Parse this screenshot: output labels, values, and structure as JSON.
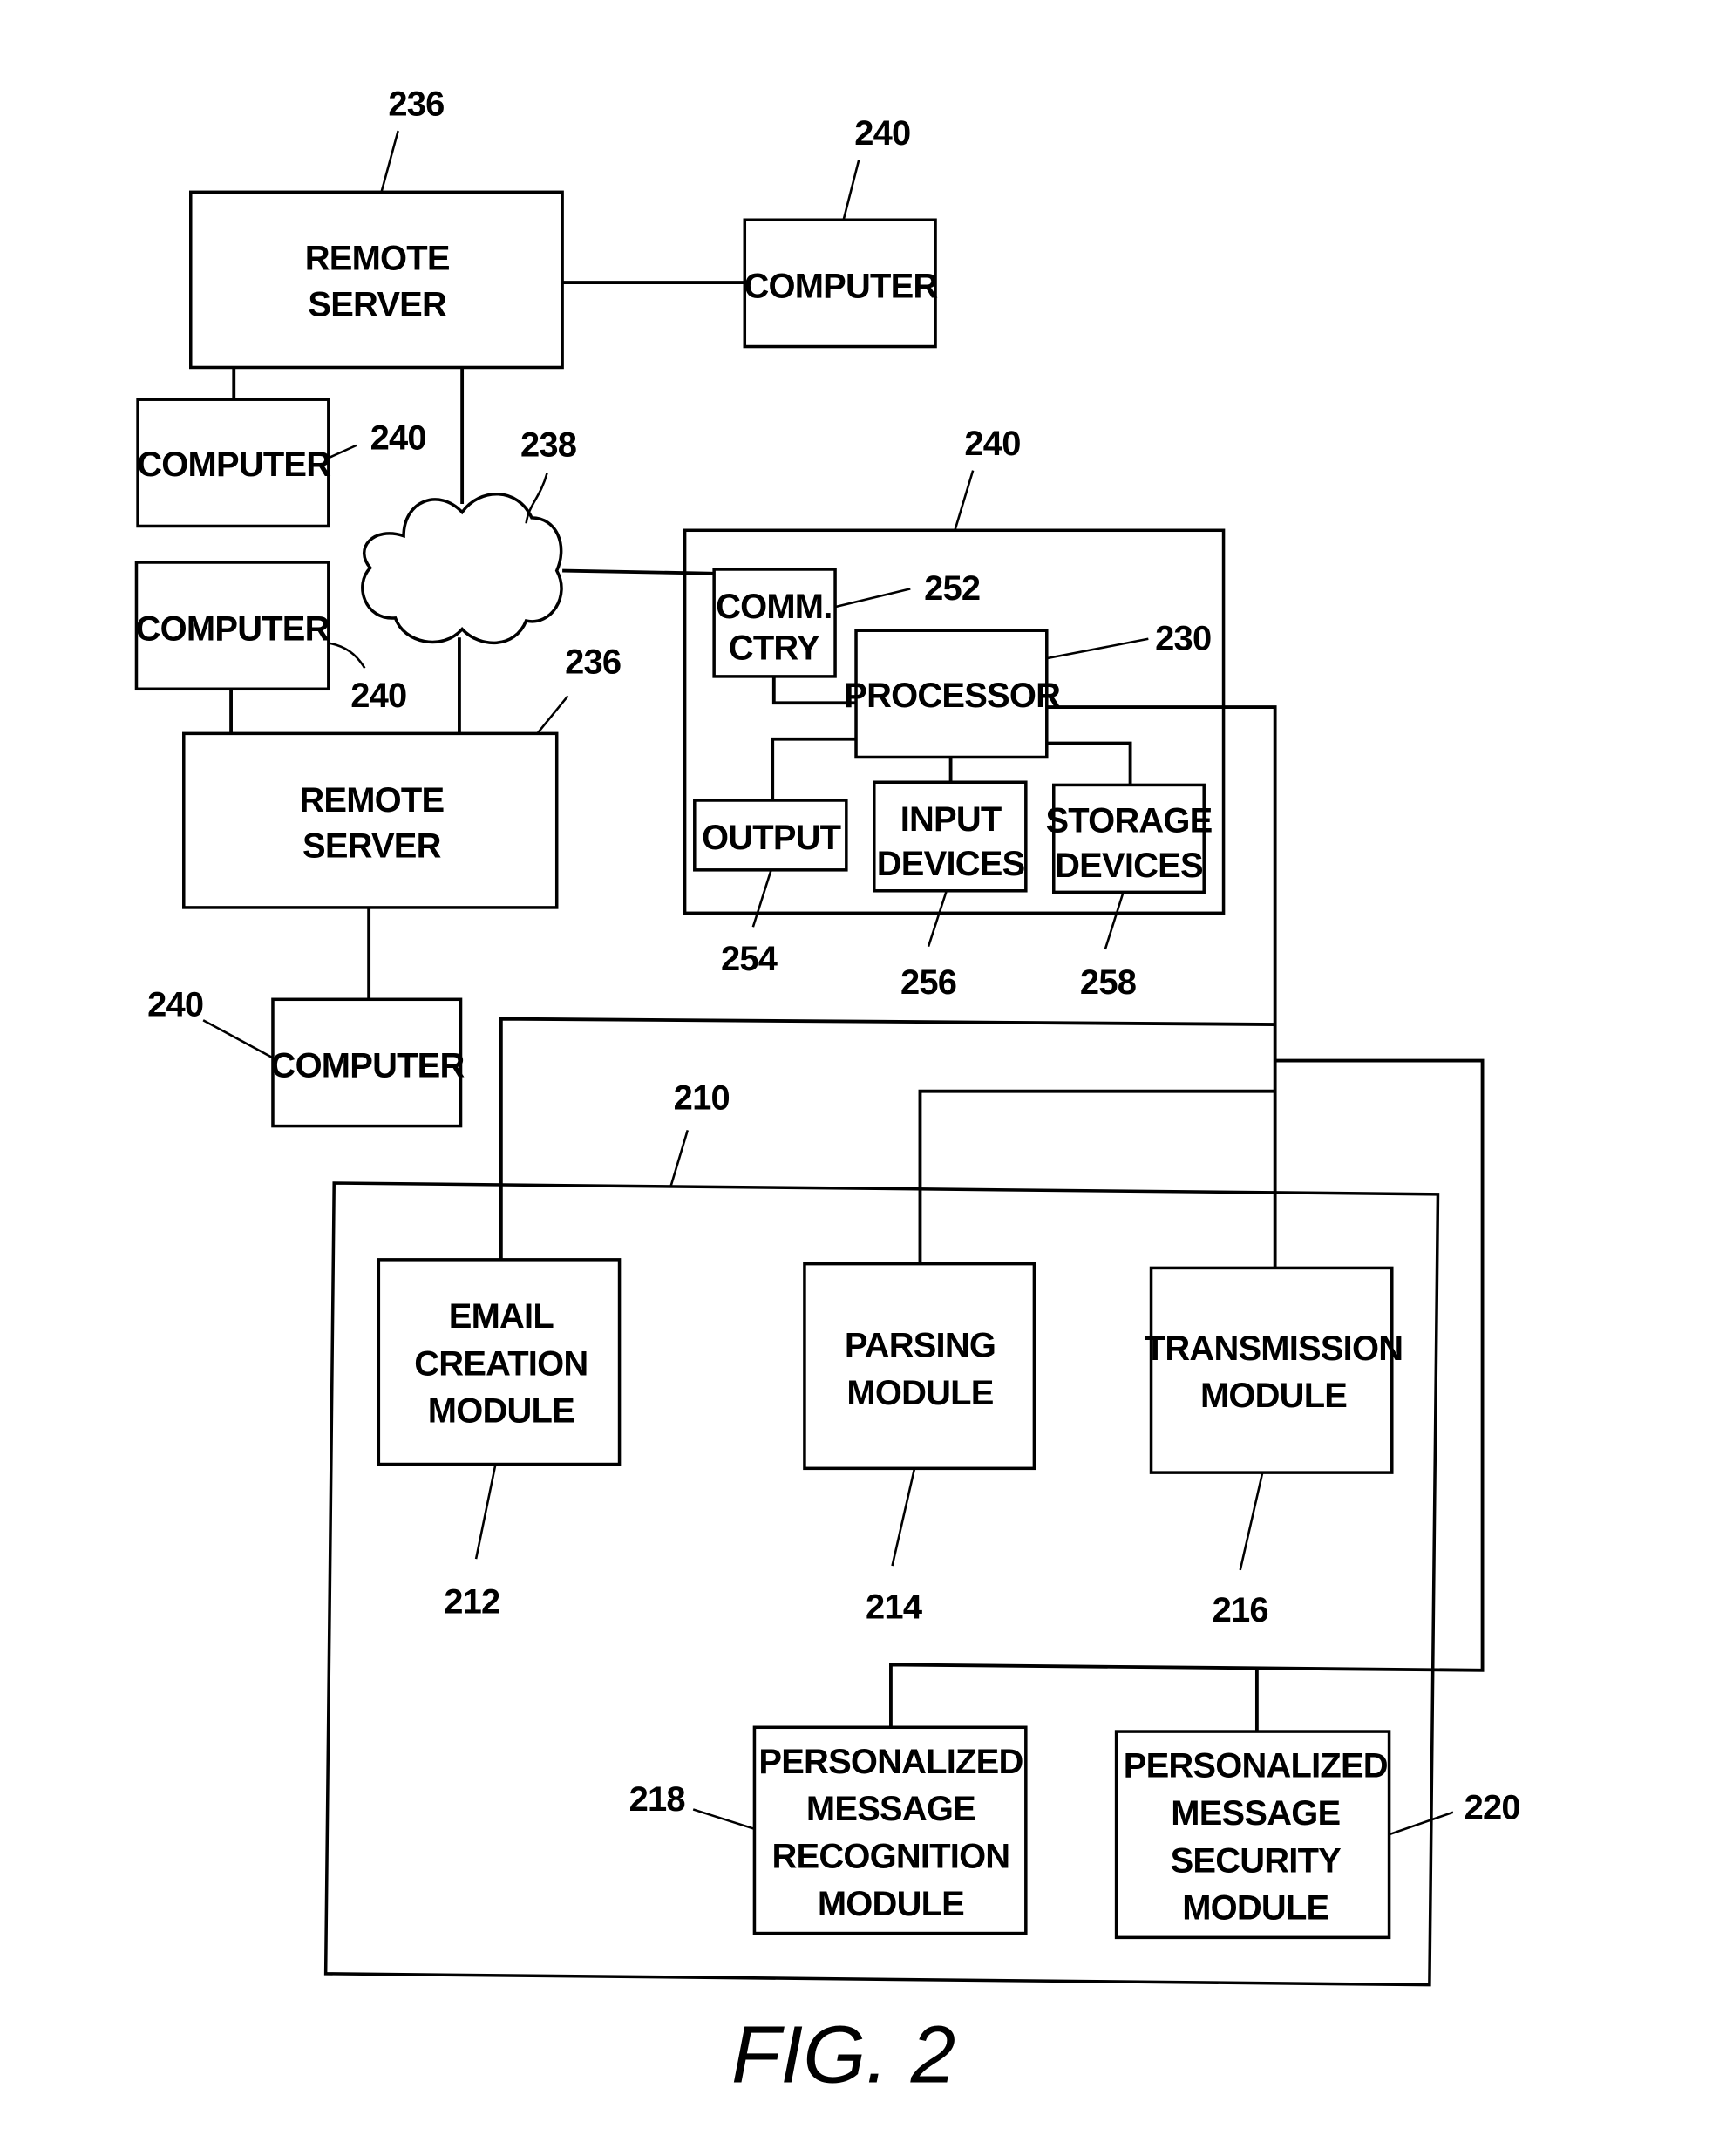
{
  "figure": {
    "caption": "FIG. 2",
    "nodes": {
      "remote_server_top": {
        "lines": [
          "REMOTE",
          "SERVER"
        ],
        "ref": "236"
      },
      "computer_top_right": {
        "lines": [
          "COMPUTER"
        ],
        "ref": "240"
      },
      "computer_left_1": {
        "lines": [
          "COMPUTER"
        ],
        "ref": "240"
      },
      "network": {
        "ref": "238"
      },
      "computer_left_2": {
        "lines": [
          "COMPUTER"
        ],
        "ref": "240"
      },
      "remote_server_bottom": {
        "lines": [
          "REMOTE",
          "SERVER"
        ],
        "ref": "236"
      },
      "computer_bottom": {
        "lines": [
          "COMPUTER"
        ],
        "ref": "240"
      },
      "computer_system": {
        "ref": "240"
      },
      "comm_ctry": {
        "lines": [
          "COMM.",
          "CTRY"
        ],
        "ref": "252"
      },
      "processor": {
        "lines": [
          "PROCESSOR"
        ],
        "ref": "230"
      },
      "output": {
        "lines": [
          "OUTPUT"
        ],
        "ref": "254"
      },
      "input_devices": {
        "lines": [
          "INPUT",
          "DEVICES"
        ],
        "ref": "256"
      },
      "storage_devices": {
        "lines": [
          "STORAGE",
          "DEVICES"
        ],
        "ref": "258"
      },
      "module_system": {
        "ref": "210"
      },
      "email_creation": {
        "lines": [
          "EMAIL",
          "CREATION",
          "MODULE"
        ],
        "ref": "212"
      },
      "parsing": {
        "lines": [
          "PARSING",
          "MODULE"
        ],
        "ref": "214"
      },
      "transmission": {
        "lines": [
          "TRANSMISSION",
          "MODULE"
        ],
        "ref": "216"
      },
      "pm_recognition": {
        "lines": [
          "PERSONALIZED",
          "MESSAGE",
          "RECOGNITION",
          "MODULE"
        ],
        "ref": "218"
      },
      "pm_security": {
        "lines": [
          "PERSONALIZED",
          "MESSAGE",
          "SECURITY",
          "MODULE"
        ],
        "ref": "220"
      }
    }
  }
}
